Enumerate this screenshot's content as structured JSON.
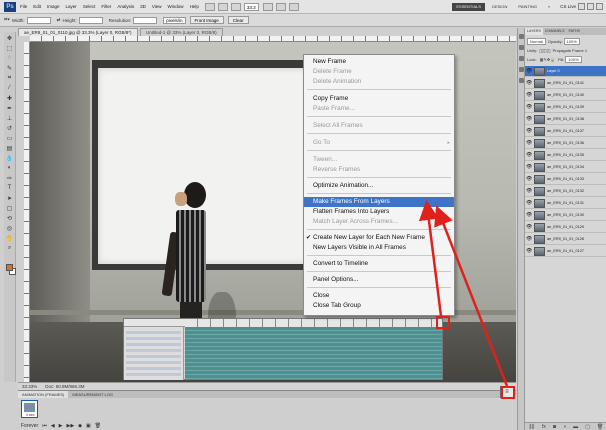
{
  "menubar": {
    "logo": "Ps",
    "items": [
      "File",
      "Edit",
      "Image",
      "Layer",
      "Select",
      "Filter",
      "Analysis",
      "3D",
      "View",
      "Window",
      "Help"
    ],
    "zoom": "33.3",
    "workspaces": [
      "ESSENTIALS",
      "DESIGN",
      "PAINTING"
    ],
    "active_workspace": "ESSENTIALS",
    "cs_live": "CS Live"
  },
  "optionsbar": {
    "width_label": "Width:",
    "height_label": "Height:",
    "resolution_label": "Resolution:",
    "resolution_unit": "pixels/in",
    "front_image_button": "Front Image",
    "clear_button": "Clear"
  },
  "document_tabs": [
    "ae_ER9_01_01_0110.jpg @ 33.3% (Layer 0, RGB/8*)",
    "Untitled-1 @ 33% (Layer 0, RGB/8)"
  ],
  "context_menu": {
    "items": [
      {
        "label": "New Frame",
        "disabled": false
      },
      {
        "label": "Delete Frame",
        "disabled": true
      },
      {
        "label": "Delete Animation",
        "disabled": true
      },
      {
        "label": "Copy Frame",
        "disabled": false
      },
      {
        "label": "Paste Frame...",
        "disabled": true
      },
      {
        "label": "Select All Frames",
        "disabled": true
      },
      {
        "label": "Go To",
        "disabled": true
      },
      {
        "label": "Tween...",
        "disabled": true
      },
      {
        "label": "Reverse Frames",
        "disabled": true
      },
      {
        "label": "Optimize Animation...",
        "disabled": false
      },
      {
        "label": "Make Frames From Layers",
        "disabled": false,
        "highlighted": true
      },
      {
        "label": "Flatten Frames Into Layers",
        "disabled": false
      },
      {
        "label": "Match Layer Across Frames...",
        "disabled": true
      },
      {
        "label": "Create New Layer for Each New Frame",
        "disabled": false,
        "checked": true
      },
      {
        "label": "New Layers Visible in All Frames",
        "disabled": false
      },
      {
        "label": "Convert to Timeline",
        "disabled": false
      },
      {
        "label": "Panel Options...",
        "disabled": false
      },
      {
        "label": "Close",
        "disabled": false
      },
      {
        "label": "Close Tab Group",
        "disabled": false
      }
    ],
    "submenu_arrow": "▸"
  },
  "statusbar": {
    "zoom": "33.33%",
    "doc": "Doc: 50.9M/966.3M"
  },
  "animation_panel": {
    "tabs": [
      "ANIMATION (FRAMES)",
      "MEASUREMENT LOG"
    ],
    "active_tab": "ANIMATION (FRAMES)",
    "frame_time": "0 sec.",
    "loop": "Forever",
    "panel_menu_icon": "≡"
  },
  "layers_panel": {
    "tabs": [
      "LAYERS",
      "CHANNELS",
      "PATHS"
    ],
    "active_tab": "LAYERS",
    "blend_mode": "Normal",
    "opacity_label": "Opacity:",
    "opacity": "100%",
    "unify_label": "Unify:",
    "propagate_label": "Propagate Frame 1",
    "lock_label": "Lock:",
    "fill_label": "Fill:",
    "fill": "100%",
    "layers": [
      {
        "name": "Layer 0",
        "selected": true
      },
      {
        "name": "ae_ER9_01_01_0141",
        "selected": false
      },
      {
        "name": "ae_ER9_01_01_0140",
        "selected": false
      },
      {
        "name": "ae_ER9_01_01_0139",
        "selected": false
      },
      {
        "name": "ae_ER9_01_01_0138",
        "selected": false
      },
      {
        "name": "ae_ER9_01_01_0137",
        "selected": false
      },
      {
        "name": "ae_ER9_01_01_0136",
        "selected": false
      },
      {
        "name": "ae_ER9_01_01_0135",
        "selected": false
      },
      {
        "name": "ae_ER9_01_01_0134",
        "selected": false
      },
      {
        "name": "ae_ER9_01_01_0133",
        "selected": false
      },
      {
        "name": "ae_ER9_01_01_0132",
        "selected": false
      },
      {
        "name": "ae_ER9_01_01_0131",
        "selected": false
      },
      {
        "name": "ae_ER9_01_01_0130",
        "selected": false
      },
      {
        "name": "ae_ER9_01_01_0129",
        "selected": false
      },
      {
        "name": "ae_ER9_01_01_0128",
        "selected": false
      },
      {
        "name": "ae_ER9_01_01_0127",
        "selected": false
      }
    ]
  },
  "colors": {
    "highlight": "#3d74c6",
    "annotation_red": "#e0201a",
    "foreground_swatch": "#e07020"
  }
}
